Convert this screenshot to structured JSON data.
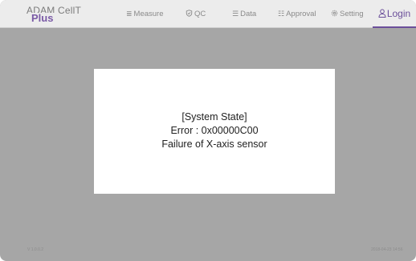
{
  "app": {
    "logo_main": "ADAM CellT",
    "logo_plus": "Plus"
  },
  "nav": {
    "measure": {
      "label": "Measure",
      "icon": "list-icon"
    },
    "qc": {
      "label": "QC",
      "icon": "shield-check-icon"
    },
    "data": {
      "label": "Data",
      "icon": "list-icon"
    },
    "approval": {
      "label": "Approval",
      "icon": "checklist-icon"
    },
    "setting": {
      "label": "Setting",
      "icon": "gear-icon"
    },
    "login": {
      "label": "Login",
      "icon": "user-icon"
    }
  },
  "modal": {
    "title": "[System State]",
    "error": "Error : 0x00000C00",
    "message": "Failure of X-axis sensor"
  },
  "footer": {
    "version": "V 1.0.0.2",
    "datetime": "2018-04-23 14:56"
  },
  "colors": {
    "accent": "#6b4f9a",
    "overlay": "#a6a6a6",
    "header_bg": "#ececec"
  }
}
